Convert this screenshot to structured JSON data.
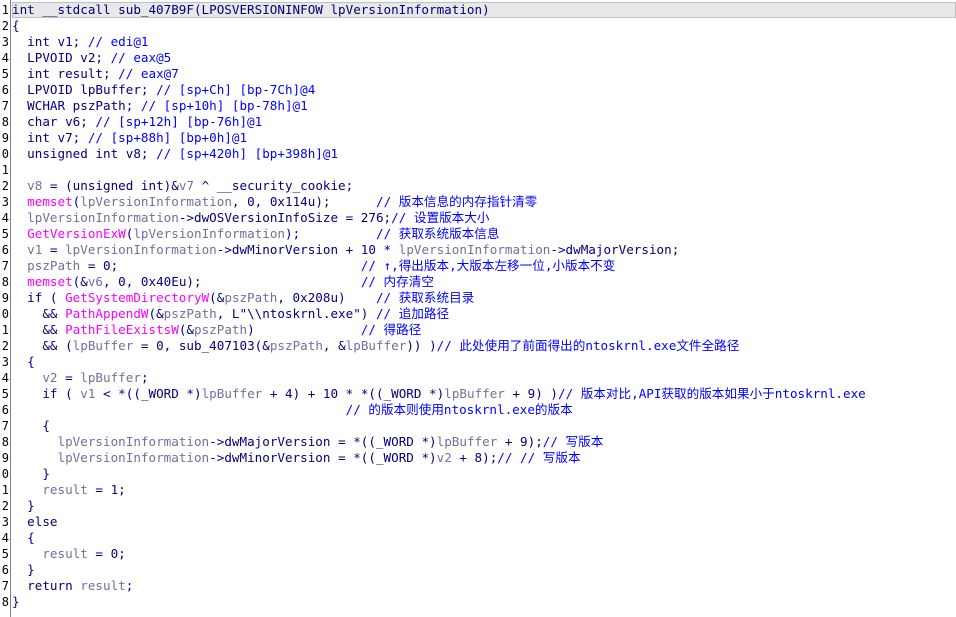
{
  "window": {
    "type": "IDA Pro Hex-Rays pseudocode view"
  },
  "colors": {
    "background": "#ffffff",
    "text": "#000080",
    "variable": "#7070a0",
    "function_call": "#ff00ff",
    "comment": "#0000ff",
    "selected_line": "#e8e8e8"
  },
  "gutter": [
    "1",
    "2",
    "3",
    "4",
    "5",
    "6",
    "7",
    "8",
    "9",
    "0",
    "1",
    "2",
    "3",
    "4",
    "5",
    "6",
    "7",
    "8",
    "9",
    "0",
    "1",
    "2",
    "3",
    "4",
    "5",
    "6",
    "7",
    "8",
    "9",
    "0",
    "1",
    "2",
    "3",
    "4",
    "5",
    "6",
    "7",
    "8"
  ],
  "lines": [
    [
      {
        "t": "int __stdcall sub_407B9F(LPOSVERSIONINFOW lpVersionInformation)",
        "c": "plain"
      }
    ],
    [
      {
        "t": "{",
        "c": "plain"
      }
    ],
    [
      {
        "t": "  int v1; ",
        "c": "plain"
      },
      {
        "t": "// edi@1",
        "c": "comment"
      }
    ],
    [
      {
        "t": "  LPVOID v2; ",
        "c": "plain"
      },
      {
        "t": "// eax@5",
        "c": "comment"
      }
    ],
    [
      {
        "t": "  int result; ",
        "c": "plain"
      },
      {
        "t": "// eax@7",
        "c": "comment"
      }
    ],
    [
      {
        "t": "  LPVOID lpBuffer; ",
        "c": "plain"
      },
      {
        "t": "// [sp+Ch] [bp-7Ch]@4",
        "c": "comment"
      }
    ],
    [
      {
        "t": "  WCHAR pszPath; ",
        "c": "plain"
      },
      {
        "t": "// [sp+10h] [bp-78h]@1",
        "c": "comment"
      }
    ],
    [
      {
        "t": "  char v6; ",
        "c": "plain"
      },
      {
        "t": "// [sp+12h] [bp-76h]@1",
        "c": "comment"
      }
    ],
    [
      {
        "t": "  int v7; ",
        "c": "plain"
      },
      {
        "t": "// [sp+88h] [bp+0h]@1",
        "c": "comment"
      }
    ],
    [
      {
        "t": "  unsigned int v8; ",
        "c": "plain"
      },
      {
        "t": "// [sp+420h] [bp+398h]@1",
        "c": "comment"
      }
    ],
    [
      {
        "t": "",
        "c": "plain"
      }
    ],
    [
      {
        "t": "  ",
        "c": "plain"
      },
      {
        "t": "v8",
        "c": "var"
      },
      {
        "t": " = (unsigned int)&",
        "c": "plain"
      },
      {
        "t": "v7",
        "c": "var"
      },
      {
        "t": " ^ __security_cookie;",
        "c": "plain"
      }
    ],
    [
      {
        "t": "  ",
        "c": "plain"
      },
      {
        "t": "memset",
        "c": "func"
      },
      {
        "t": "(",
        "c": "plain"
      },
      {
        "t": "lpVersionInformation",
        "c": "var"
      },
      {
        "t": ", 0, 0x114u);      ",
        "c": "plain"
      },
      {
        "t": "// 版本信息的内存指针清零",
        "c": "comment"
      }
    ],
    [
      {
        "t": "  ",
        "c": "plain"
      },
      {
        "t": "lpVersionInformation",
        "c": "var"
      },
      {
        "t": "->dwOSVersionInfoSize = 276;",
        "c": "plain"
      },
      {
        "t": "// 设置版本大小",
        "c": "comment"
      }
    ],
    [
      {
        "t": "  ",
        "c": "plain"
      },
      {
        "t": "GetVersionExW",
        "c": "func"
      },
      {
        "t": "(",
        "c": "plain"
      },
      {
        "t": "lpVersionInformation",
        "c": "var"
      },
      {
        "t": ");          ",
        "c": "plain"
      },
      {
        "t": "// 获取系统版本信息",
        "c": "comment"
      }
    ],
    [
      {
        "t": "  ",
        "c": "plain"
      },
      {
        "t": "v1",
        "c": "var"
      },
      {
        "t": " = ",
        "c": "plain"
      },
      {
        "t": "lpVersionInformation",
        "c": "var"
      },
      {
        "t": "->dwMinorVersion + 10 * ",
        "c": "plain"
      },
      {
        "t": "lpVersionInformation",
        "c": "var"
      },
      {
        "t": "->dwMajorVersion;",
        "c": "plain"
      }
    ],
    [
      {
        "t": "  ",
        "c": "plain"
      },
      {
        "t": "pszPath",
        "c": "var"
      },
      {
        "t": " = 0;                                ",
        "c": "plain"
      },
      {
        "t": "// ↑,得出版本,大版本左移一位,小版本不变",
        "c": "comment"
      }
    ],
    [
      {
        "t": "  ",
        "c": "plain"
      },
      {
        "t": "memset",
        "c": "func"
      },
      {
        "t": "(&",
        "c": "plain"
      },
      {
        "t": "v6",
        "c": "var"
      },
      {
        "t": ", 0, 0x40Eu);                     ",
        "c": "plain"
      },
      {
        "t": "// 内存清空",
        "c": "comment"
      }
    ],
    [
      {
        "t": "  if ( ",
        "c": "plain"
      },
      {
        "t": "GetSystemDirectoryW",
        "c": "func"
      },
      {
        "t": "(&",
        "c": "plain"
      },
      {
        "t": "pszPath",
        "c": "var"
      },
      {
        "t": ", 0x208u)    ",
        "c": "plain"
      },
      {
        "t": "// 获取系统目录",
        "c": "comment"
      }
    ],
    [
      {
        "t": "    && ",
        "c": "plain"
      },
      {
        "t": "PathAppendW",
        "c": "func"
      },
      {
        "t": "(&",
        "c": "plain"
      },
      {
        "t": "pszPath",
        "c": "var"
      },
      {
        "t": ", L\"\\\\ntoskrnl.exe\") ",
        "c": "plain"
      },
      {
        "t": "// 追加路径",
        "c": "comment"
      }
    ],
    [
      {
        "t": "    && ",
        "c": "plain"
      },
      {
        "t": "PathFileExistsW",
        "c": "func"
      },
      {
        "t": "(&",
        "c": "plain"
      },
      {
        "t": "pszPath",
        "c": "var"
      },
      {
        "t": ")              ",
        "c": "plain"
      },
      {
        "t": "// 得路径",
        "c": "comment"
      }
    ],
    [
      {
        "t": "    && (",
        "c": "plain"
      },
      {
        "t": "lpBuffer",
        "c": "var"
      },
      {
        "t": " = 0, sub_407103(&",
        "c": "plain"
      },
      {
        "t": "pszPath",
        "c": "var"
      },
      {
        "t": ", &",
        "c": "plain"
      },
      {
        "t": "lpBuffer",
        "c": "var"
      },
      {
        "t": ")) )",
        "c": "plain"
      },
      {
        "t": "// 此处使用了前面得出的ntoskrnl.exe文件全路径",
        "c": "comment"
      }
    ],
    [
      {
        "t": "  {",
        "c": "plain"
      }
    ],
    [
      {
        "t": "    ",
        "c": "plain"
      },
      {
        "t": "v2",
        "c": "var"
      },
      {
        "t": " = ",
        "c": "plain"
      },
      {
        "t": "lpBuffer",
        "c": "var"
      },
      {
        "t": ";",
        "c": "plain"
      }
    ],
    [
      {
        "t": "    if ( ",
        "c": "plain"
      },
      {
        "t": "v1",
        "c": "var"
      },
      {
        "t": " < *((_WORD *)",
        "c": "plain"
      },
      {
        "t": "lpBuffer",
        "c": "var"
      },
      {
        "t": " + 4) + 10 * *((_WORD *)",
        "c": "plain"
      },
      {
        "t": "lpBuffer",
        "c": "var"
      },
      {
        "t": " + 9) )",
        "c": "plain"
      },
      {
        "t": "// 版本对比,API获取的版本如果小于ntoskrnl.exe",
        "c": "comment"
      }
    ],
    [
      {
        "t": "                                            ",
        "c": "plain"
      },
      {
        "t": "// 的版本则使用ntoskrnl.exe的版本",
        "c": "comment"
      }
    ],
    [
      {
        "t": "    {",
        "c": "plain"
      }
    ],
    [
      {
        "t": "      ",
        "c": "plain"
      },
      {
        "t": "lpVersionInformation",
        "c": "var"
      },
      {
        "t": "->dwMajorVersion = *((_WORD *)",
        "c": "plain"
      },
      {
        "t": "lpBuffer",
        "c": "var"
      },
      {
        "t": " + 9);",
        "c": "plain"
      },
      {
        "t": "// 写版本",
        "c": "comment"
      }
    ],
    [
      {
        "t": "      ",
        "c": "plain"
      },
      {
        "t": "lpVersionInformation",
        "c": "var"
      },
      {
        "t": "->dwMinorVersion = *((_WORD *)",
        "c": "plain"
      },
      {
        "t": "v2",
        "c": "var"
      },
      {
        "t": " + 8);",
        "c": "plain"
      },
      {
        "t": "// // 写版本",
        "c": "comment"
      }
    ],
    [
      {
        "t": "    }",
        "c": "plain"
      }
    ],
    [
      {
        "t": "    ",
        "c": "plain"
      },
      {
        "t": "result",
        "c": "var"
      },
      {
        "t": " = 1;",
        "c": "plain"
      }
    ],
    [
      {
        "t": "  }",
        "c": "plain"
      }
    ],
    [
      {
        "t": "  else",
        "c": "plain"
      }
    ],
    [
      {
        "t": "  {",
        "c": "plain"
      }
    ],
    [
      {
        "t": "    ",
        "c": "plain"
      },
      {
        "t": "result",
        "c": "var"
      },
      {
        "t": " = 0;",
        "c": "plain"
      }
    ],
    [
      {
        "t": "  }",
        "c": "plain"
      }
    ],
    [
      {
        "t": "  return ",
        "c": "plain"
      },
      {
        "t": "result",
        "c": "var"
      },
      {
        "t": ";",
        "c": "plain"
      }
    ],
    [
      {
        "t": "}",
        "c": "plain"
      }
    ]
  ]
}
